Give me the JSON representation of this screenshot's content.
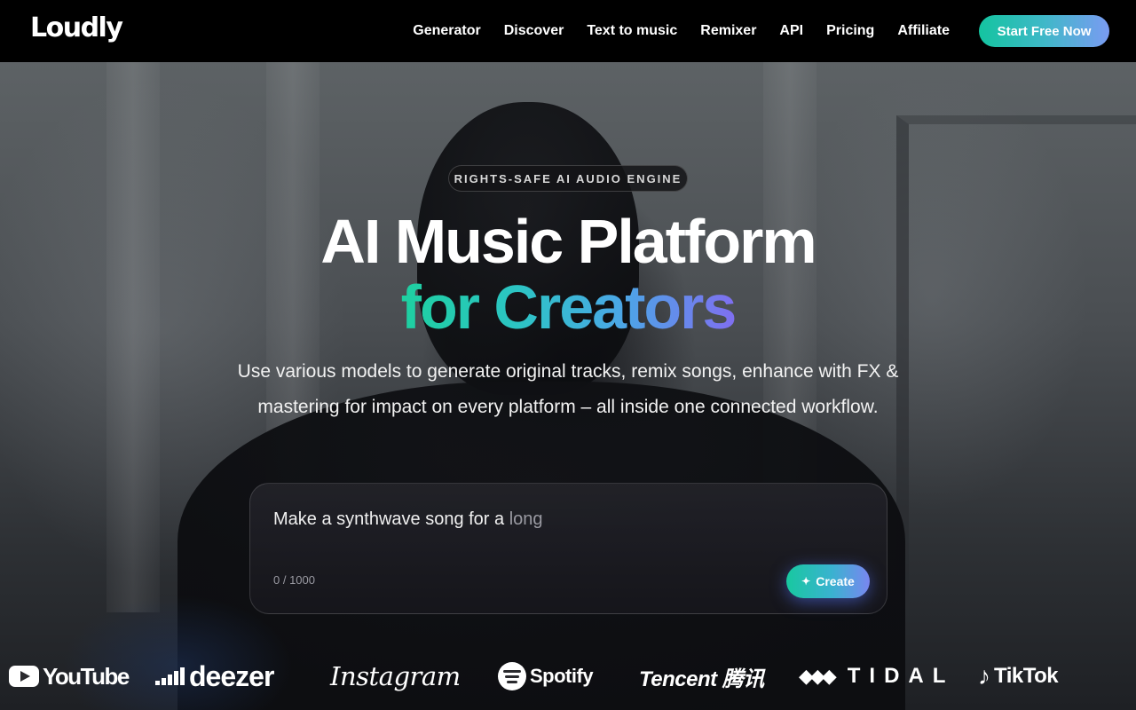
{
  "nav": {
    "logo": "Loudly",
    "links": [
      "Generator",
      "Discover",
      "Text to music",
      "Remixer",
      "API",
      "Pricing",
      "Affiliate"
    ],
    "cta_label": "Start Free Now"
  },
  "hero": {
    "badge": "RIGHTS-SAFE AI AUDIO ENGINE",
    "title_line1": "AI Music Platform",
    "title_line2": "for Creators",
    "subtitle_line1": "Use various models to generate original tracks, remix songs, enhance with FX &",
    "subtitle_line2": "mastering for impact on every platform – all inside one connected workflow."
  },
  "prompt": {
    "typed_text": "Make a synthwave song for a",
    "faded_text": "long",
    "counter": "0 / 1000",
    "create_label": "Create",
    "create_icon": "sparkle-icon"
  },
  "partners": {
    "youtube": "YouTube",
    "deezer": "deezer",
    "instagram": "Instagram",
    "spotify": "Spotify",
    "tencent": "Tencent 腾讯",
    "tidal": "TIDAL",
    "tiktok": "TikTok"
  },
  "colors": {
    "nav_bg": "#000000",
    "accent_start": "#14c4a0",
    "accent_end": "#7a9bf2"
  }
}
